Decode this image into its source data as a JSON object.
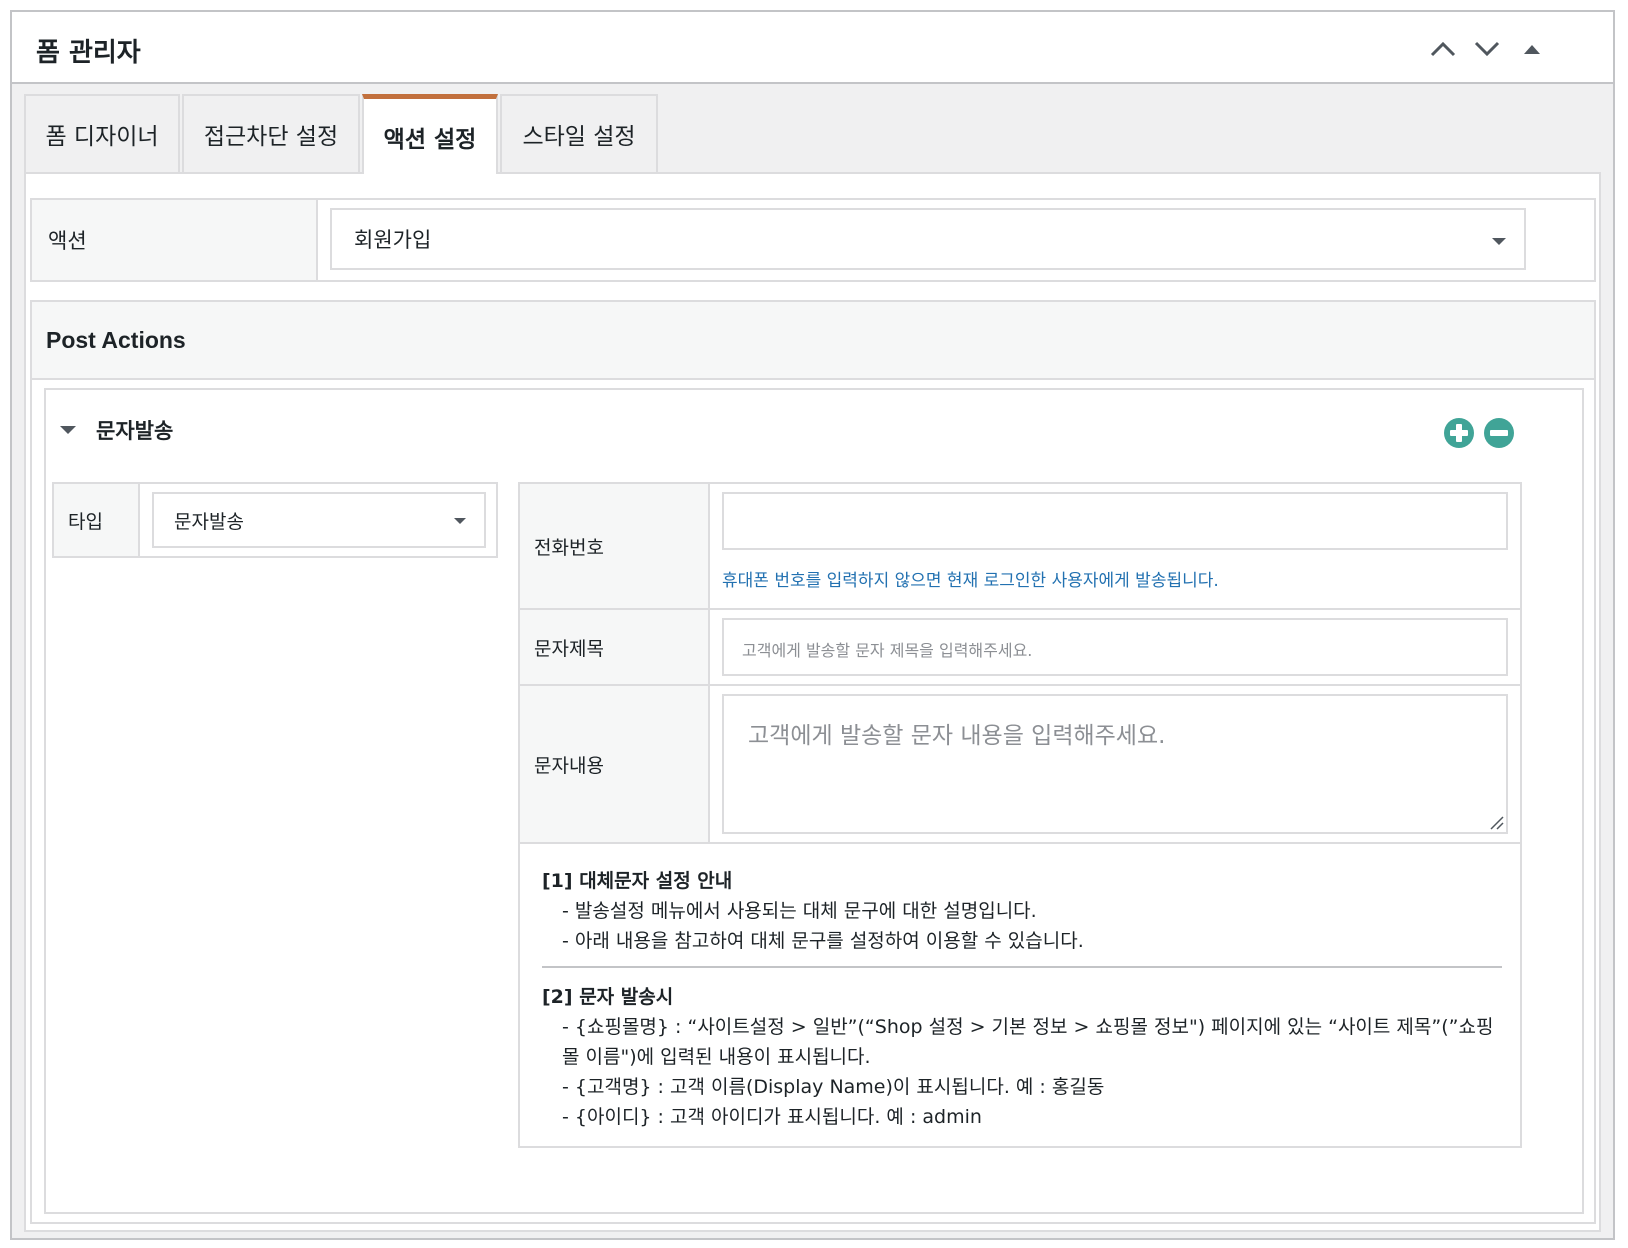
{
  "panel": {
    "title": "폼 관리자",
    "controls": {
      "move_up": "chevron-up-icon",
      "move_down": "chevron-down-icon",
      "toggle": "triangle-up-icon"
    }
  },
  "tabs": [
    {
      "label": "폼 디자이너",
      "active": false
    },
    {
      "label": "접근차단 설정",
      "active": false
    },
    {
      "label": "액션 설정",
      "active": true
    },
    {
      "label": "스타일 설정",
      "active": false
    }
  ],
  "action": {
    "label": "액션",
    "value": "회원가입"
  },
  "post_actions": {
    "title": "Post Actions",
    "item": {
      "title": "문자발송",
      "type_label": "타입",
      "type_value": "문자발송",
      "fields": {
        "phone": {
          "label": "전화번호",
          "value": "",
          "help": "휴대폰 번호를 입력하지 않으면 현재 로그인한 사용자에게 발송됩니다."
        },
        "subject": {
          "label": "문자제목",
          "placeholder": "고객에게 발송할 문자 제목을 입력해주세요."
        },
        "content": {
          "label": "문자내용",
          "placeholder": "고객에게 발송할 문자 내용을 입력해주세요."
        }
      },
      "info": {
        "s1_title": "[1] 대체문자 설정 안내",
        "s1_items": [
          "- 발송설정 메뉴에서 사용되는 대체 문구에 대한 설명입니다.",
          "- 아래 내용을 참고하여 대체 문구를 설정하여 이용할 수 있습니다."
        ],
        "s2_title": "[2] 문자 발송시",
        "s2_items": [
          "- {쇼핑몰명} : “사이트설정 > 일반”(“Shop 설정 > 기본 정보 > 쇼핑몰 정보\") 페이지에 있는 “사이트 제목”(”쇼핑몰 이름\")에 입력된 내용이 표시됩니다.",
          "- {고객명} : 고객 이름(Display Name)이 표시됩니다. 예 : 홍길동",
          "- {아이디} : 고객 아이디가 표시됩니다. 예 : admin"
        ]
      }
    }
  },
  "colors": {
    "accent_tab": "#c2703d",
    "action_button": "#40a497",
    "help_text": "#2271b1"
  }
}
